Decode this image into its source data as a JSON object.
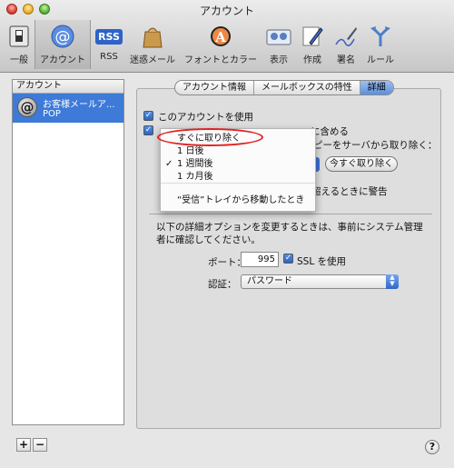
{
  "window": {
    "title": "アカウント"
  },
  "toolbar": {
    "items": [
      {
        "label": "一般"
      },
      {
        "label": "アカウント"
      },
      {
        "label": "RSS",
        "badge": "RSS"
      },
      {
        "label": "迷惑メール"
      },
      {
        "label": "フォントとカラー"
      },
      {
        "label": "表示"
      },
      {
        "label": "作成"
      },
      {
        "label": "署名"
      },
      {
        "label": "ルール"
      }
    ]
  },
  "sidebar": {
    "header": "アカウント",
    "account": {
      "name": "お客様メールア...",
      "type": "POP",
      "icon": "at-icon"
    },
    "add_label": "+",
    "remove_label": "−"
  },
  "tabs": [
    {
      "label": "アカウント情報"
    },
    {
      "label": "メールボックスの特性"
    },
    {
      "label": "詳細"
    }
  ],
  "advanced": {
    "use_account": "このアカウントを使用",
    "include_tail": "に含める",
    "remove_copy_tail": "ピーをサーバから取り除く：",
    "remove_now_button": "今すぐ取り除く",
    "warn_tail": "超えるときに警告",
    "admin_note": "以下の詳細オプションを変更するときは、事前にシステム管理者に確認してください。",
    "port_label": "ポート：",
    "port_value": "995",
    "ssl_label": "SSL を使用",
    "auth_label": "認証：",
    "auth_value": "パスワード"
  },
  "menu": {
    "items": [
      {
        "label": "すぐに取り除く",
        "checked": false
      },
      {
        "label": "1 日後",
        "checked": false
      },
      {
        "label": "1 週間後",
        "checked": true
      },
      {
        "label": "1 カ月後",
        "checked": false
      },
      {
        "label": "“受信”トレイから移動したとき",
        "checked": false
      }
    ],
    "check_mark": "✓"
  },
  "help": {
    "label": "?"
  },
  "colors": {
    "selection": "#3e7ad8",
    "highlight_ellipse": "#e32222"
  }
}
